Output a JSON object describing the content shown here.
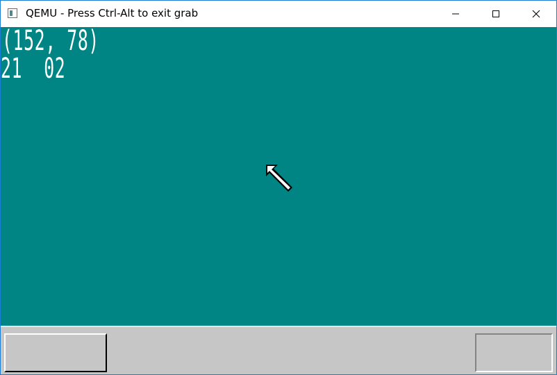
{
  "window": {
    "title": "QEMU - Press Ctrl-Alt to exit grab",
    "icon": "qemu-app-icon",
    "controls": {
      "minimize_icon": "minimize-icon",
      "maximize_icon": "maximize-icon",
      "close_icon": "close-icon"
    },
    "border_color": "#1a7fd4"
  },
  "guest_screen": {
    "background_color": "#008484",
    "mouse_coords_text": "(152, 78)",
    "key_code_text": "21  02",
    "text_color": "#ffffff",
    "cursor_icon": "arrow-cursor-icon"
  },
  "taskbar": {
    "background_color": "#c6c6c6",
    "start_button_label": "",
    "tray_label": ""
  }
}
